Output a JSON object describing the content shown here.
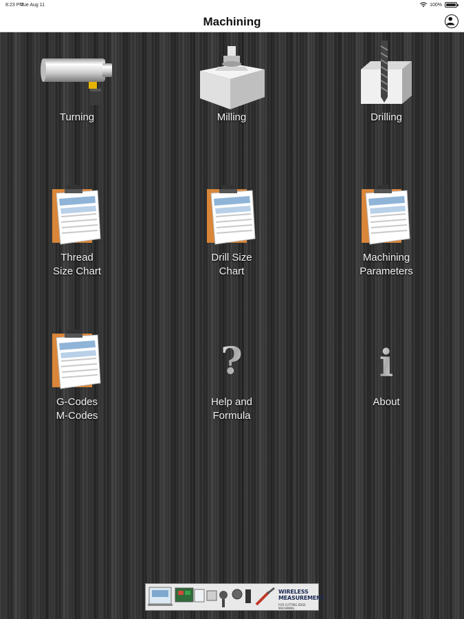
{
  "status_bar": {
    "time": "8:23 PM",
    "date": "Tue Aug 11",
    "battery": "100%"
  },
  "nav": {
    "title": "Machining",
    "profile_icon": "person-circle-icon"
  },
  "tiles": [
    {
      "label_lines": [
        "Turning"
      ],
      "icon": "lathe-turning-icon"
    },
    {
      "label_lines": [
        "Milling"
      ],
      "icon": "milling-block-icon"
    },
    {
      "label_lines": [
        "Drilling"
      ],
      "icon": "drill-block-icon"
    },
    {
      "label_lines": [
        "Thread",
        "Size Chart"
      ],
      "icon": "clipboard-chart-icon"
    },
    {
      "label_lines": [
        "Drill Size",
        "Chart"
      ],
      "icon": "clipboard-chart-icon"
    },
    {
      "label_lines": [
        "Machining",
        "Parameters"
      ],
      "icon": "clipboard-chart-icon"
    },
    {
      "label_lines": [
        "G-Codes",
        "M-Codes"
      ],
      "icon": "clipboard-chart-icon"
    },
    {
      "label_lines": [
        "Help and",
        "Formula"
      ],
      "icon": "question-mark-icon"
    },
    {
      "label_lines": [
        "About"
      ],
      "icon": "info-icon"
    }
  ],
  "banner": {
    "line1": "WIRELESS",
    "line2": "MEASUREMENT",
    "tagline": "FOR CUTTING EDGE MACHINING"
  },
  "colors": {
    "background": "#2d2d2d",
    "label": "#f2f2f2",
    "nav_background": "#ffffff"
  }
}
